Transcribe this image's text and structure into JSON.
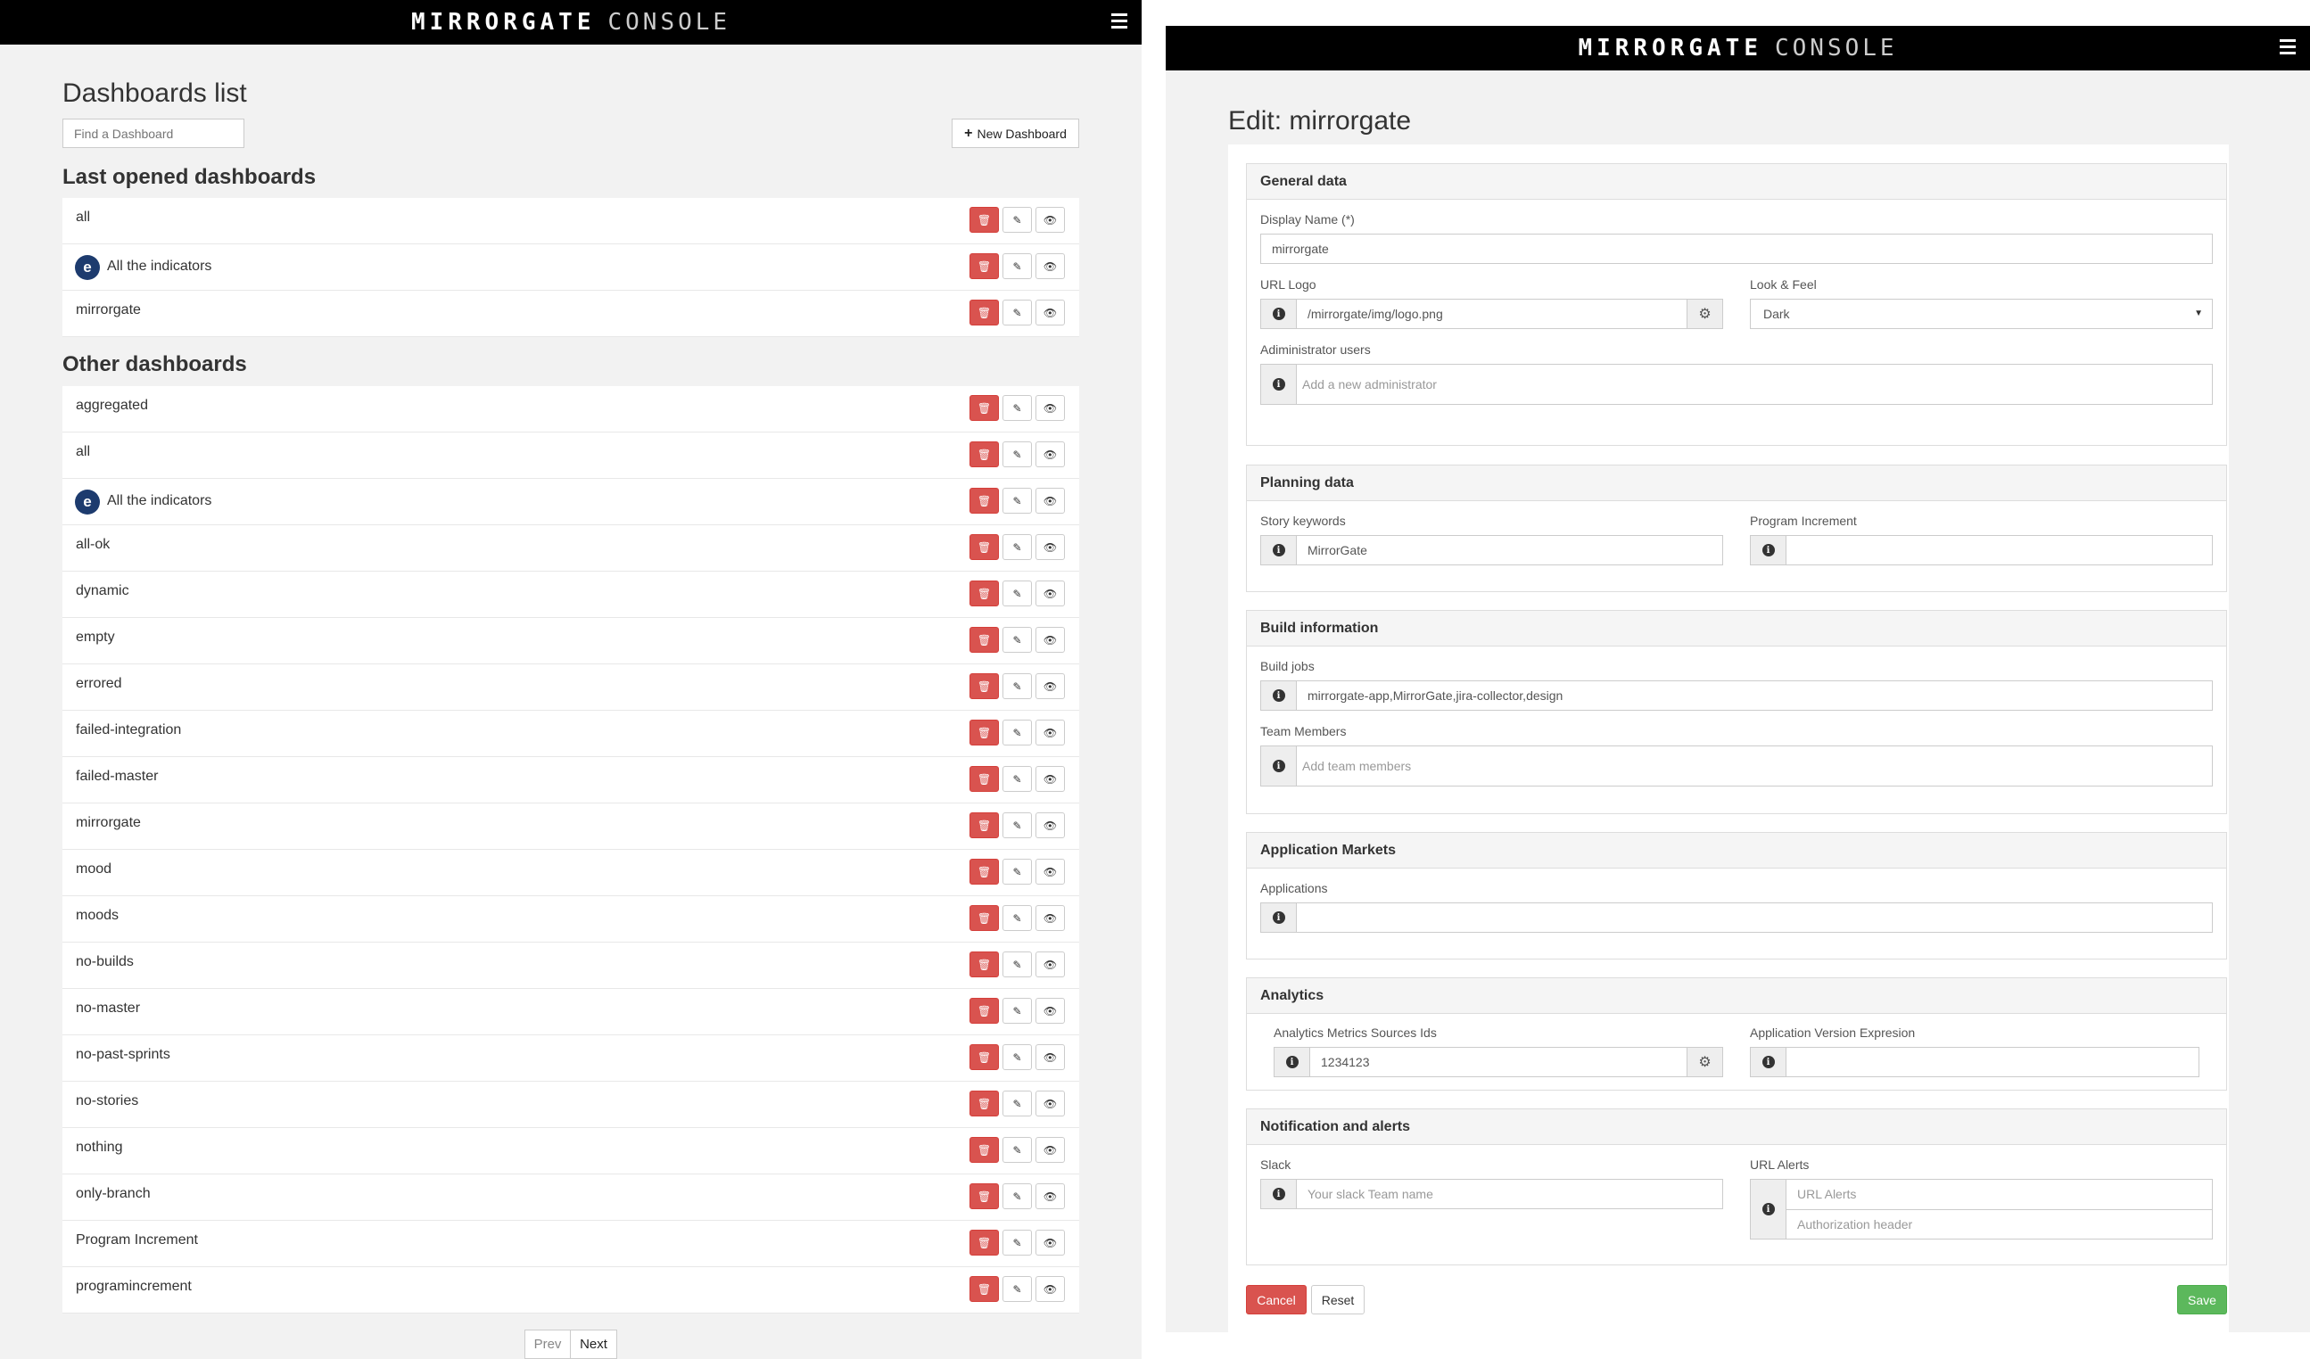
{
  "brand": {
    "logo_bold": "MIRRORGATE",
    "logo_light": "CONSOLE"
  },
  "list_page": {
    "title": "Dashboards list",
    "search_placeholder": "Find a Dashboard",
    "new_button": "New Dashboard",
    "last_opened_heading": "Last opened dashboards",
    "last_opened": [
      {
        "name": "all",
        "has_avatar": false
      },
      {
        "name": "All the indicators",
        "has_avatar": true
      },
      {
        "name": "mirrorgate",
        "has_avatar": false
      }
    ],
    "other_heading": "Other dashboards",
    "others": [
      {
        "name": "aggregated",
        "has_avatar": false
      },
      {
        "name": "all",
        "has_avatar": false
      },
      {
        "name": "All the indicators",
        "has_avatar": true
      },
      {
        "name": "all-ok",
        "has_avatar": false
      },
      {
        "name": "dynamic",
        "has_avatar": false
      },
      {
        "name": "empty",
        "has_avatar": false
      },
      {
        "name": "errored",
        "has_avatar": false
      },
      {
        "name": "failed-integration",
        "has_avatar": false
      },
      {
        "name": "failed-master",
        "has_avatar": false
      },
      {
        "name": "mirrorgate",
        "has_avatar": false
      },
      {
        "name": "mood",
        "has_avatar": false
      },
      {
        "name": "moods",
        "has_avatar": false
      },
      {
        "name": "no-builds",
        "has_avatar": false
      },
      {
        "name": "no-master",
        "has_avatar": false
      },
      {
        "name": "no-past-sprints",
        "has_avatar": false
      },
      {
        "name": "no-stories",
        "has_avatar": false
      },
      {
        "name": "nothing",
        "has_avatar": false
      },
      {
        "name": "only-branch",
        "has_avatar": false
      },
      {
        "name": "Program Increment",
        "has_avatar": false
      },
      {
        "name": "programincrement",
        "has_avatar": false
      }
    ],
    "pager": {
      "prev": "Prev",
      "next": "Next"
    }
  },
  "edit_page": {
    "title": "Edit: mirrorgate",
    "general": {
      "heading": "General data",
      "display_name_label": "Display Name (*)",
      "display_name_value": "mirrorgate",
      "url_logo_label": "URL Logo",
      "url_logo_value": "/mirrorgate/img/logo.png",
      "look_label": "Look & Feel",
      "look_value": "Dark",
      "admins_label": "Adiministrator users",
      "admins_placeholder": "Add a new administrator"
    },
    "planning": {
      "heading": "Planning data",
      "story_label": "Story keywords",
      "story_value": "MirrorGate",
      "pi_label": "Program Increment",
      "pi_value": ""
    },
    "build": {
      "heading": "Build information",
      "jobs_label": "Build jobs",
      "jobs_value": "mirrorgate-app,MirrorGate,jira-collector,design",
      "team_label": "Team Members",
      "team_placeholder": "Add team members"
    },
    "markets": {
      "heading": "Application Markets",
      "apps_label": "Applications",
      "apps_value": ""
    },
    "analytics": {
      "heading": "Analytics",
      "sources_label": "Analytics Metrics Sources Ids",
      "sources_value": "1234123",
      "version_label": "Application Version Expresion",
      "version_value": ""
    },
    "notifications": {
      "heading": "Notification and alerts",
      "slack_label": "Slack",
      "slack_placeholder": "Your slack Team name",
      "alerts_label": "URL Alerts",
      "alerts_placeholder": "URL Alerts",
      "auth_placeholder": "Authorization header"
    },
    "buttons": {
      "cancel": "Cancel",
      "reset": "Reset",
      "save": "Save"
    }
  },
  "colors": {
    "danger": "#d9534f",
    "success": "#5cb85c",
    "topbar": "#000000"
  }
}
